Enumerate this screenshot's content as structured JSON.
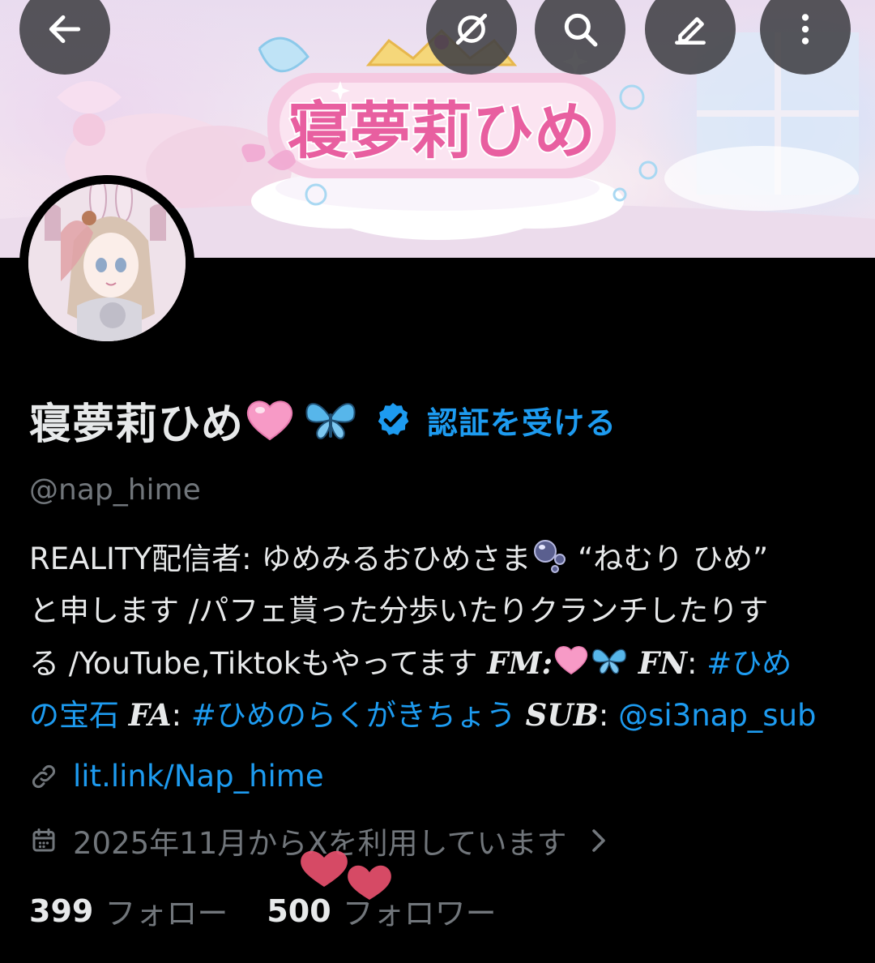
{
  "nav": {
    "back_icon": "arrow-left-icon",
    "grok_icon": "grok-slash-icon",
    "search_icon": "search-icon",
    "edit_icon": "pencil-icon",
    "more_icon": "more-vertical-icon"
  },
  "banner": {
    "logo_text": "寝夢莉ひめ"
  },
  "profile": {
    "display_name": "寝夢莉ひめ",
    "name_emojis": [
      "pink-heart",
      "butterfly"
    ],
    "get_verified_label": "認証を受ける",
    "handle": "@nap_hime"
  },
  "bio": {
    "line1_a": "REALITY配信者: ゆめみるおひめさま",
    "line1_b": " “ねむり ひめ”",
    "line2": "と申します /パフェ貰った分歩いたりクランチしたりす",
    "line3_a": "る /YouTube,Tiktokもやってます ",
    "fm_label": "FM",
    "fn_label": "FN",
    "fn_tag_part1": "#ひめ",
    "fn_tag_part2": "の宝石",
    "fa_label": "FA",
    "fa_tag": "#ひめのらくがきちょう",
    "sub_label": "SUB",
    "sub_handle": "@si3nap_sub"
  },
  "meta": {
    "website": "lit.link/Nap_hime",
    "joined": "2025年11月からXを利用しています"
  },
  "stats": {
    "following_count": "399",
    "following_label": "フォロー",
    "followers_count": "500",
    "followers_label": "フォロワー"
  },
  "colors": {
    "accent_blue": "#1d9bf0",
    "muted_gray": "#71767b",
    "text": "#e7e9ea",
    "background": "#000000"
  }
}
